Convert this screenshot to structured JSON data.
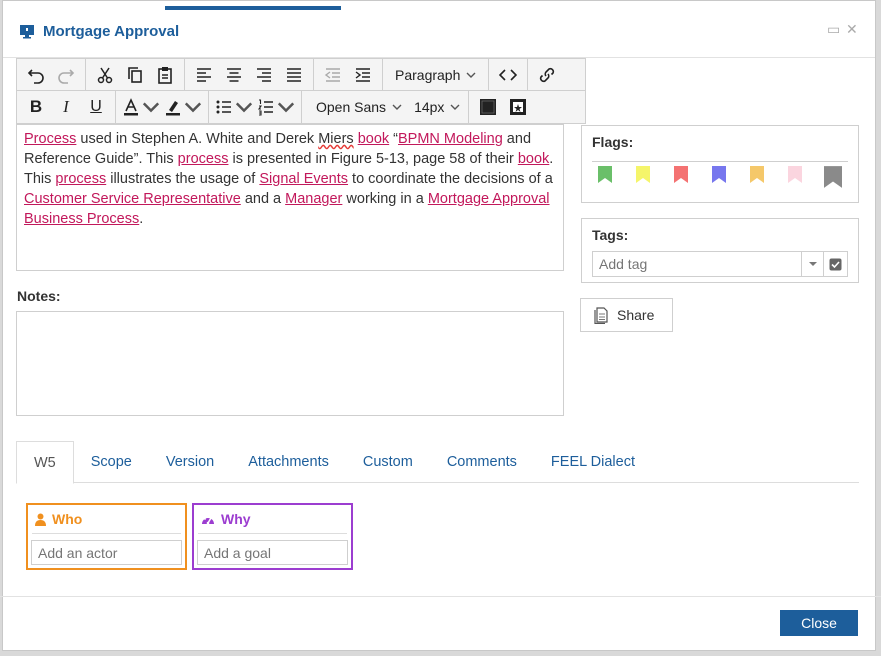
{
  "window": {
    "title": "Mortgage Approval"
  },
  "toolbar": {
    "block_format": "Paragraph",
    "font_family": "Open Sans",
    "font_size": "14px",
    "icons": [
      "undo-icon",
      "redo-icon",
      "cut-icon",
      "copy-icon",
      "paste-icon",
      "align-left-icon",
      "align-center-icon",
      "align-right-icon",
      "justify-icon",
      "outdent-icon",
      "indent-icon",
      "source-code-icon",
      "link-icon",
      "bold-icon",
      "italic-icon",
      "underline-icon",
      "text-color-icon",
      "highlight-icon",
      "bullet-list-icon",
      "numbered-list-icon",
      "fill-icon",
      "image-icon"
    ]
  },
  "description": {
    "segments": [
      {
        "text": "Process",
        "link": true
      },
      {
        "text": " used in Stephen A. White and Derek ",
        "link": false
      },
      {
        "text": "Miers",
        "spell": true
      },
      {
        "text": " ",
        "link": false
      },
      {
        "text": "book",
        "link": true
      },
      {
        "text": " “",
        "link": false
      },
      {
        "text": "BPMN Modeling",
        "link": true
      },
      {
        "text": " and Reference Guide”. This ",
        "link": false
      },
      {
        "text": "process",
        "link": true
      },
      {
        "text": " is presented in Figure 5-13, page 58 of their ",
        "link": false
      },
      {
        "text": "book",
        "link": true
      },
      {
        "text": ". This ",
        "link": false
      },
      {
        "text": "process",
        "link": true
      },
      {
        "text": " illustrates the usage of ",
        "link": false
      },
      {
        "text": "Signal Events",
        "link": true
      },
      {
        "text": " to coordinate the decisions of a ",
        "link": false
      },
      {
        "text": "Customer Service Representative",
        "link": true
      },
      {
        "text": " and a ",
        "link": false
      },
      {
        "text": "Manager",
        "link": true
      },
      {
        "text": " working in a ",
        "link": false
      },
      {
        "text": "Mortgage Approval Business Process",
        "link": true
      },
      {
        "text": ".",
        "link": false
      }
    ]
  },
  "notes": {
    "label": "Notes:"
  },
  "flags": {
    "label": "Flags:",
    "colors": [
      "#6abf69",
      "#f5f56a",
      "#f47272",
      "#7777ee",
      "#f5c86a",
      "#fbd5df",
      "#8a8a8a"
    ]
  },
  "tags": {
    "label": "Tags:",
    "placeholder": "Add tag"
  },
  "share": {
    "label": "Share"
  },
  "tabs": [
    {
      "label": "W5",
      "active": true
    },
    {
      "label": "Scope"
    },
    {
      "label": "Version"
    },
    {
      "label": "Attachments"
    },
    {
      "label": "Custom"
    },
    {
      "label": "Comments"
    },
    {
      "label": "FEEL Dialect"
    }
  ],
  "w5": {
    "who": {
      "label": "Who",
      "placeholder": "Add an actor",
      "color": "#f0901f"
    },
    "why": {
      "label": "Why",
      "placeholder": "Add a goal",
      "color": "#9c3dd0"
    }
  },
  "footer": {
    "close_label": "Close"
  }
}
